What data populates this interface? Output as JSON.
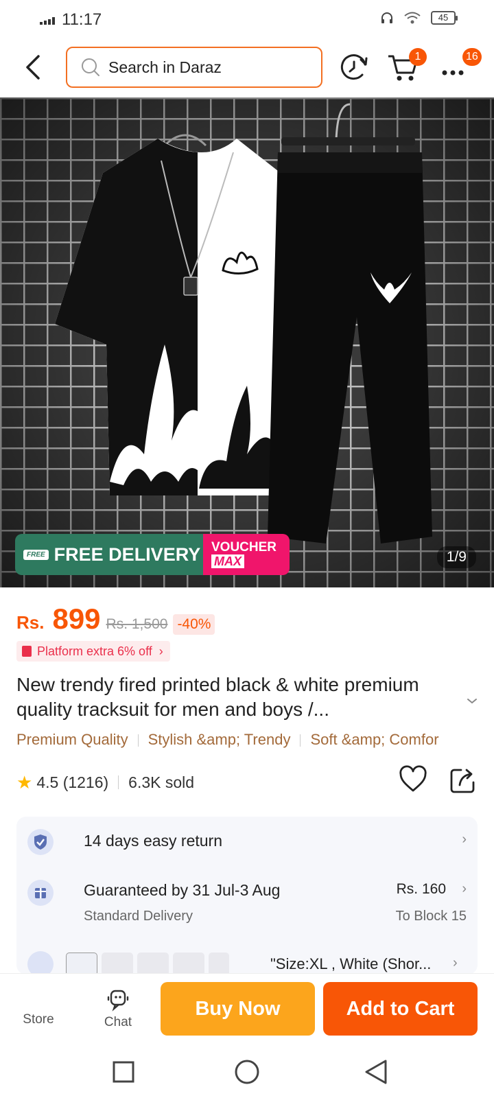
{
  "status_bar": {
    "time": "11:17",
    "battery": "45"
  },
  "header": {
    "search_placeholder": "Search in Daraz",
    "cart_badge": "1",
    "more_badge": "16"
  },
  "hero": {
    "image_counter": "1/9",
    "promo_free_label": "FREE",
    "promo_free_delivery": "FREE DELIVERY",
    "promo_voucher_1": "VOUCHER",
    "promo_voucher_2": "MAX"
  },
  "price": {
    "currency": "Rs.",
    "value": "899",
    "original": "Rs. 1,500",
    "discount": "-40%"
  },
  "platform_tag": "Platform extra 6% off",
  "title": "New trendy fired printed black & white premium quality tracksuit for men and boys /...",
  "tags": [
    "Premium Quality",
    "Stylish &amp; Trendy",
    "Soft &amp; Comfor"
  ],
  "rating": {
    "score": "4.5",
    "count": "(1216)",
    "sold": "6.3K sold"
  },
  "info": {
    "return_text": "14 days easy return",
    "delivery_text": "Guaranteed by 31 Jul-3 Aug",
    "delivery_sub": "Standard Delivery",
    "delivery_fee": "Rs. 160",
    "delivery_to": "To Block 15",
    "variant_text": "\"Size:XL , White (Shor..."
  },
  "bottom": {
    "store_label": "Store",
    "chat_label": "Chat",
    "buy_now": "Buy Now",
    "add_to_cart": "Add to Cart"
  },
  "colors": {
    "accent": "#f85606",
    "buy_now": "#fca51c",
    "free_delivery": "#2e7a5f",
    "voucher": "#f0156b",
    "tag_text": "#a36a3a"
  }
}
